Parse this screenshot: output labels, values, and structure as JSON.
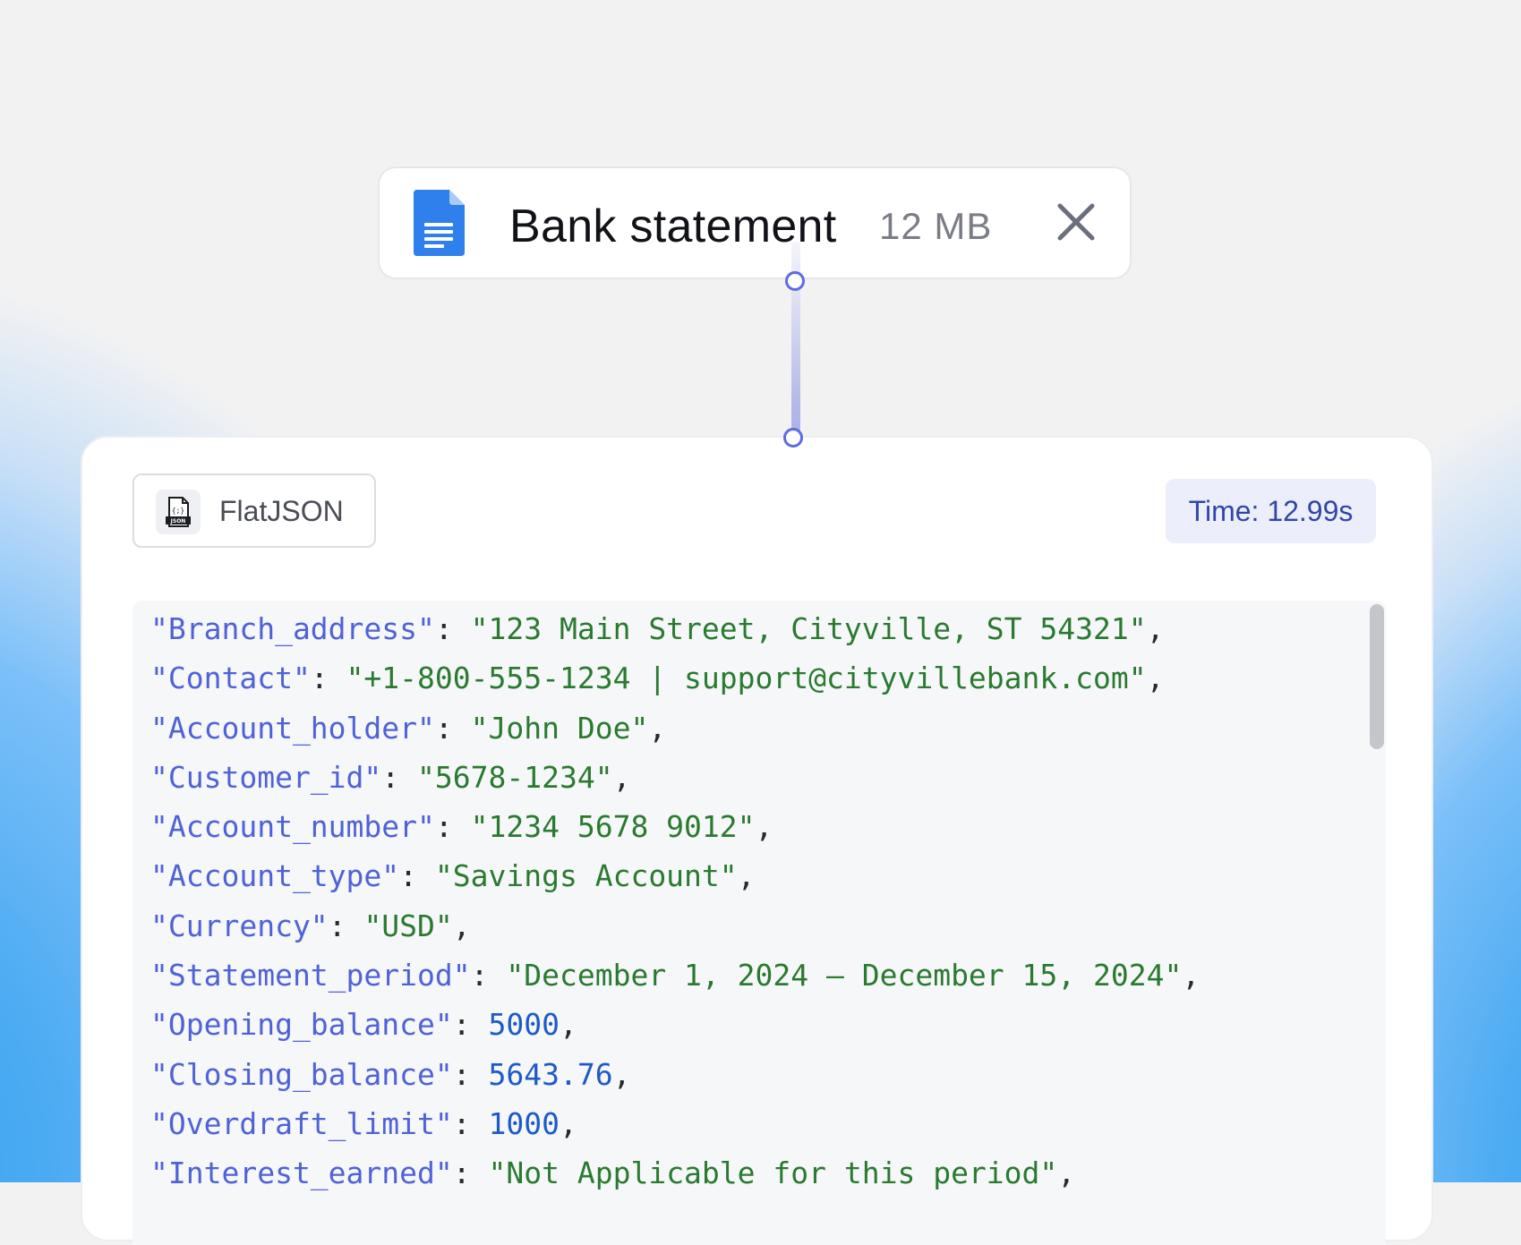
{
  "colors": {
    "accent": "#5c6ce0",
    "key": "#4f62d6",
    "string": "#2a7a2f",
    "number": "#1d5ac9",
    "badge_bg": "#eceffb",
    "badge_text": "#3146a8",
    "doc_icon": "#2f80ed"
  },
  "file": {
    "icon": "document-icon",
    "name": "Bank statement",
    "size": "12 MB",
    "close_icon": "close-icon"
  },
  "result": {
    "format": {
      "icon": "json-file-icon",
      "label": "FlatJSON"
    },
    "time": "Time: 12.99s",
    "lines": [
      {
        "key": "\"Branch_address\"",
        "value": "\"123 Main Street, Cityville, ST 54321\"",
        "type": "s",
        "sep": ","
      },
      {
        "key": "\"Contact\"",
        "value": "\"+1-800-555-1234 | support@cityvillebank.com\"",
        "type": "s",
        "sep": ","
      },
      {
        "key": "\"Account_holder\"",
        "value": "\"John Doe\"",
        "type": "s",
        "sep": ","
      },
      {
        "key": "\"Customer_id\"",
        "value": "\"5678-1234\"",
        "type": "s",
        "sep": ","
      },
      {
        "key": "\"Account_number\"",
        "value": "\"1234 5678 9012\"",
        "type": "s",
        "sep": ","
      },
      {
        "key": "\"Account_type\"",
        "value": "\"Savings Account\"",
        "type": "s",
        "sep": ","
      },
      {
        "key": "\"Currency\"",
        "value": "\"USD\"",
        "type": "s",
        "sep": ","
      },
      {
        "key": "\"Statement_period\"",
        "value": "\"December 1, 2024 – December 15, 2024\"",
        "type": "s",
        "sep": ","
      },
      {
        "key": "\"Opening_balance\"",
        "value": "5000",
        "type": "n",
        "sep": ","
      },
      {
        "key": "\"Closing_balance\"",
        "value": "5643.76",
        "type": "n",
        "sep": ","
      },
      {
        "key": "\"Overdraft_limit\"",
        "value": "1000",
        "type": "n",
        "sep": ","
      },
      {
        "key": "\"Interest_earned\"",
        "value": "\"Not Applicable for this period\"",
        "type": "s",
        "sep": ","
      }
    ]
  }
}
